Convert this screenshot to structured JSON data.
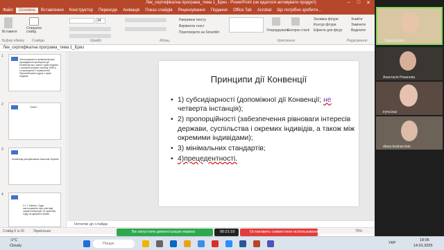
{
  "window": {
    "title": "Лек_сертифікатна програма_тема 1_Бриз - PowerPoint (не вдалося активувати продукт)",
    "brand_color": "#b7472a"
  },
  "menu": [
    "Файл",
    "Основне",
    "Вставлення",
    "Конструктор",
    "Переходи",
    "Анімація",
    "Показ слайдів",
    "Рецензування",
    "Подання",
    "Office Tab",
    "Acrobat",
    "Що потрібно зробити..."
  ],
  "ribbon": {
    "paste": "Вставити",
    "new_slide": "Створити слайд",
    "font_size": "24",
    "direction": "Напрямок тексту",
    "align": "Вирівняти текст",
    "smartart": "Перетворити на SmartArt",
    "arrange": "Упорядкувати",
    "quick_styles": "Експрес-стилі",
    "fill": "Заливка фігури",
    "outline": "Контур фігури",
    "effects": "Ефекти для фігур",
    "find": "Знайти",
    "replace": "Замінити",
    "select": "Виділити",
    "groups": [
      "Буфер обміну",
      "Слайди",
      "Шрифт",
      "Абзац",
      "Креслення",
      "Редагування"
    ]
  },
  "file_tab": "Лек_сертифікатна програма_тема 1_Бриз",
  "thumbnails": [
    {
      "num": "1",
      "text": "Застосування в кримінальному провадженні принципів дії Конвенції про захист прав людини і основоположних свобод 1950 р. та принципів її тлумачення Європейським судом з прав людини"
    },
    {
      "num": "2",
      "text": "ПЛАН:"
    },
    {
      "num": "3",
      "text": "Конвенція ратифікована Законом України"
    },
    {
      "num": "4",
      "text": "Ст. 1 Закону: Суди застосовують при розгляді справ Конвенцію та практику Суду як джерело права"
    }
  ],
  "slide": {
    "title": "Принципи дії Конвенції",
    "bullets": [
      {
        "a": "1) субсидіарності (допоміжної дії Конвенції; ",
        "b": "не",
        "c": " четверта інстанція);"
      },
      {
        "a": "2) пропорційності (забезпечення рівноваги інтересів держави, суспільства і окремих індивідів, а також між окремими індивідами);",
        "b": "",
        "c": ""
      },
      {
        "a": "3) мінімальних стандартів;",
        "b": "",
        "c": ""
      },
      {
        "a": "4)прецедентності.",
        "b": "",
        "c": ""
      }
    ]
  },
  "notes_placeholder": "Нотатки до слайда",
  "status": {
    "slide": "Слайд 5 із 15",
    "lang": "Українська",
    "zoom": "75%"
  },
  "meeting": {
    "sharing": "Ви запустили демонстрацію екрана",
    "timer": "00:21:10",
    "stop": "Остановить совместное использование",
    "participants": [
      {
        "name": "Лариса Бриз"
      },
      {
        "name": "Анастасія Рязанова"
      },
      {
        "name": "iryna.baz"
      },
      {
        "name": "diana bodnarchuk"
      }
    ]
  },
  "taskbar": {
    "weather_temp": "-1°C",
    "weather_text": "Cloudy",
    "search_placeholder": "Пошук",
    "lang": "УКР",
    "time": "18:06",
    "date": "14.01.2025"
  }
}
